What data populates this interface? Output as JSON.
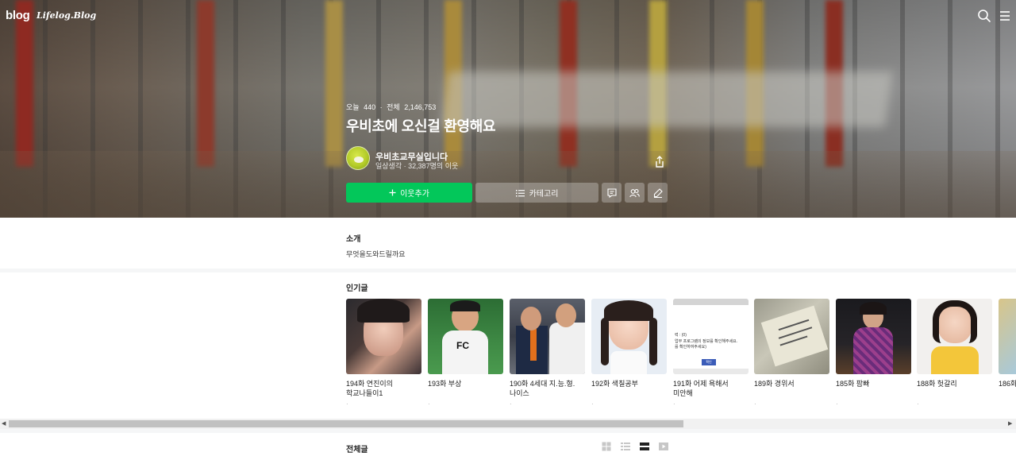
{
  "topbar": {
    "logo": "blog",
    "logo_sub": "Lifelog.Blog"
  },
  "hero": {
    "today_label": "오늘",
    "today_count": "440",
    "total_label": "전체",
    "total_count": "2,146,753",
    "title": "우비초에 오신걸 환영해요",
    "owner_name": "우비초교무실입니다",
    "owner_sub": "일상생각 · 32,387명의 이웃",
    "add_neighbor_label": "이웃추가",
    "category_label": "카테고리"
  },
  "intro": {
    "heading": "소개",
    "text": "무엇을도와드릴까요"
  },
  "popular": {
    "heading": "인기글",
    "posts": [
      {
        "title": "194화 연진이의 학교나들이1",
        "date": "·"
      },
      {
        "title": "193화 부상",
        "date": "·"
      },
      {
        "title": "190화 4세대 지.능.형.나이스",
        "date": "·"
      },
      {
        "title": "192화 색칠공부",
        "date": "·"
      },
      {
        "title": "191화 어제 욕해서 미안해",
        "date": "·"
      },
      {
        "title": "189화 경위서",
        "date": "·"
      },
      {
        "title": "185화 팜빠",
        "date": "·"
      },
      {
        "title": "188화 헛갈리",
        "date": "·"
      },
      {
        "title": "186화",
        "date": ""
      }
    ],
    "dialog_thumb": {
      "line1": "력 : (0)",
      "line2": "업무 프로그램의 정보를 확인해주세요.",
      "line3": "를 확인하여주세요)",
      "button": "확인"
    }
  },
  "allposts": {
    "heading": "전체글"
  },
  "icons": {
    "search": "search-icon",
    "menu": "menu-icon",
    "share": "share-icon",
    "plus": "plus-icon",
    "list": "list-icon",
    "comment": "comment-icon",
    "neighbors": "neighbors-icon",
    "write": "write-icon",
    "view_album": "album-view-icon",
    "view_list": "list-view-icon",
    "view_card": "card-view-icon",
    "view_video": "video-view-icon"
  },
  "colors": {
    "accent": "#03c75a"
  }
}
